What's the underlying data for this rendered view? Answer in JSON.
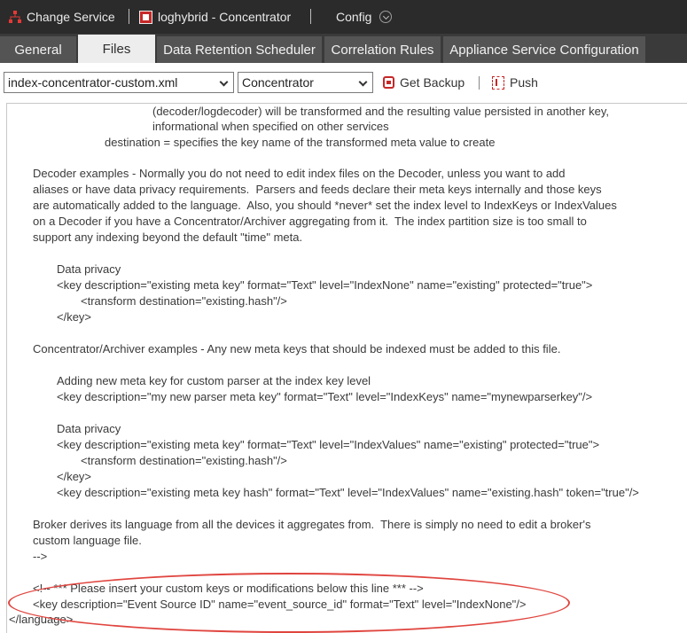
{
  "topbar": {
    "service_label": "Change Service",
    "device_label": "loghybrid - Concentrator",
    "config_label": "Config"
  },
  "tabs": [
    {
      "label": "General",
      "active": false
    },
    {
      "label": "Files",
      "active": true
    },
    {
      "label": "Data Retention Scheduler",
      "active": false
    },
    {
      "label": "Correlation Rules",
      "active": false
    },
    {
      "label": "Appliance Service Configuration",
      "active": false
    }
  ],
  "toolbar": {
    "file_select_value": "index-concentrator-custom.xml",
    "service_select_value": "Concentrator",
    "get_backup_label": "Get Backup",
    "push_label": "Push"
  },
  "editor": {
    "lines": [
      "(decoder/logdecoder) will be transformed and the resulting value persisted in another key,",
      "informational when specified on other services",
      "destination = specifies the key name of the transformed meta value to create",
      "Decoder examples - Normally you do not need to edit index files on the Decoder, unless you want to add",
      "aliases or have data privacy requirements.  Parsers and feeds declare their meta keys internally and those keys",
      "are automatically added to the language.  Also, you should *never* set the index level to IndexKeys or IndexValues",
      "on a Decoder if you have a Concentrator/Archiver aggregating from it.  The index partition size is too small to",
      "support any indexing beyond the default \"time\" meta.",
      "Data privacy",
      "<key description=\"existing meta key\" format=\"Text\" level=\"IndexNone\" name=\"existing\" protected=\"true\">",
      "<transform destination=\"existing.hash\"/>",
      "</key>",
      "Concentrator/Archiver examples - Any new meta keys that should be indexed must be added to this file.",
      "Adding new meta key for custom parser at the index key level",
      "<key description=\"my new parser meta key\" format=\"Text\" level=\"IndexKeys\" name=\"mynewparserkey\"/>",
      "Data privacy",
      "<key description=\"existing meta key\" format=\"Text\" level=\"IndexValues\" name=\"existing\" protected=\"true\">",
      "<transform destination=\"existing.hash\"/>",
      "</key>",
      "<key description=\"existing meta key hash\" format=\"Text\" level=\"IndexValues\" name=\"existing.hash\" token=\"true\"/>",
      "Broker derives its language from all the devices it aggregates from.  There is simply no need to edit a broker's",
      "custom language file.",
      "-->",
      "<!-- *** Please insert your custom keys or modifications below this line *** -->",
      "<key description=\"Event Source ID\" name=\"event_source_id\" format=\"Text\" level=\"IndexNone\"/>",
      "</language>"
    ]
  },
  "colors": {
    "topbar_bg": "#2b2b2b",
    "tab_bg": "#545454",
    "tab_active_bg": "#ededed",
    "accent_red": "#c62828",
    "highlight_ellipse": "#e0453f"
  }
}
